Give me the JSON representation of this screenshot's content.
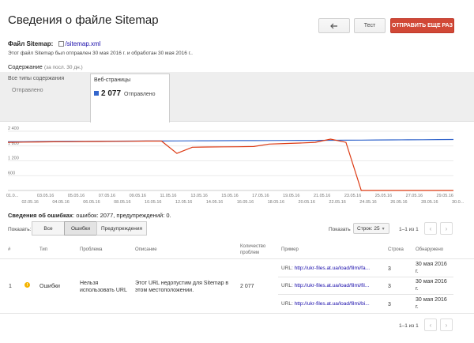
{
  "header": {
    "title": "Сведения о файле Sitemap",
    "back_icon": "back-arrow-icon",
    "test_label": "Тест",
    "resubmit_label": "ОТПРАВИТЬ ЕЩЕ РАЗ"
  },
  "file": {
    "label": "Файл Sitemap:",
    "link": "/sitemap.xml",
    "info": "Этот файл Sitemap был отправлен 30 мая 2016 г. и обработан 30 мая 2016 г.."
  },
  "content": {
    "label": "Содержание",
    "period": "(за посл. 30 дн.)"
  },
  "tabs": {
    "all": {
      "title": "Все типы содержания",
      "sub": "Отправлено"
    },
    "web": {
      "title": "Веб-страницы",
      "count": "2 077",
      "sub": "Отправлено"
    }
  },
  "chart_data": {
    "type": "line",
    "y_ticks": [
      "2 400",
      "1 800",
      "1 200",
      "600"
    ],
    "ylim": [
      0,
      2400
    ],
    "x_top": [
      "01.0...",
      "03.05.16",
      "05.05.16",
      "07.05.16",
      "09.05.16",
      "11.05.16",
      "13.05.16",
      "15.05.16",
      "17.05.16",
      "19.05.16",
      "21.05.16",
      "23.05.16",
      "25.05.16",
      "27.05.16",
      "29.05.16"
    ],
    "x_bottom": [
      "02.05.16",
      "04.05.16",
      "06.05.16",
      "08.05.16",
      "10.05.16",
      "12.05.16",
      "14.05.16",
      "16.05.16",
      "18.05.16",
      "20.05.16",
      "22.05.16",
      "24.05.16",
      "26.05.16",
      "28.05.16",
      "30.0..."
    ],
    "series": [
      {
        "color": "#3366cc",
        "values": [
          1970,
          1975,
          1980,
          1985,
          1990,
          1992,
          1995,
          1998,
          2000,
          2002,
          2004,
          2006,
          2010,
          2012,
          2015,
          2018,
          2020,
          2022,
          2025,
          2028,
          2030,
          2033,
          2035,
          2040,
          2045,
          2048,
          2050,
          2055,
          2060,
          2065
        ]
      },
      {
        "color": "#dc3912",
        "values": [
          1950,
          1960,
          1965,
          1970,
          1975,
          1980,
          1985,
          1990,
          1995,
          2000,
          2000,
          1500,
          1750,
          1760,
          1765,
          1770,
          1780,
          1880,
          1900,
          1920,
          1950,
          2080,
          1950,
          0,
          0,
          0,
          0,
          0,
          0,
          0
        ]
      }
    ]
  },
  "errors": {
    "title": "Сведения об ошибках",
    "summary": ": ошибок: 2077, предупреждений: 0.",
    "show_label": "Показать:",
    "filters": [
      "Все",
      "Ошибки",
      "Предупреждения"
    ],
    "rows_label": "Показать",
    "rows_value": "Строк: 25",
    "pager": "1–1 из 1",
    "columns": {
      "num": "#",
      "type": "Тип",
      "problem": "Проблема",
      "description": "Описание",
      "count": "Количество проблем",
      "example": "Пример",
      "line": "Строка",
      "detected": "Обнаружено"
    },
    "row": {
      "num": "1",
      "type": "Ошибки",
      "problem": "Нельзя использовать URL",
      "description": "Этот URL недопустим для Sitemap в этом местоположении.",
      "count": "2 077",
      "examples": [
        {
          "prefix": "URL:",
          "url": "http://ukr-files.at.ua/load/filmi/fa...",
          "line": "3",
          "date": "30 мая 2016 г."
        },
        {
          "prefix": "URL:",
          "url": "http://ukr-files.at.ua/load/filmi/fil...",
          "line": "3",
          "date": "30 мая 2016 г."
        },
        {
          "prefix": "URL:",
          "url": "http://ukr-files.at.ua/load/filmi/bi...",
          "line": "3",
          "date": "30 мая 2016 г."
        }
      ]
    },
    "pager_bottom": "1–1 из 1"
  }
}
